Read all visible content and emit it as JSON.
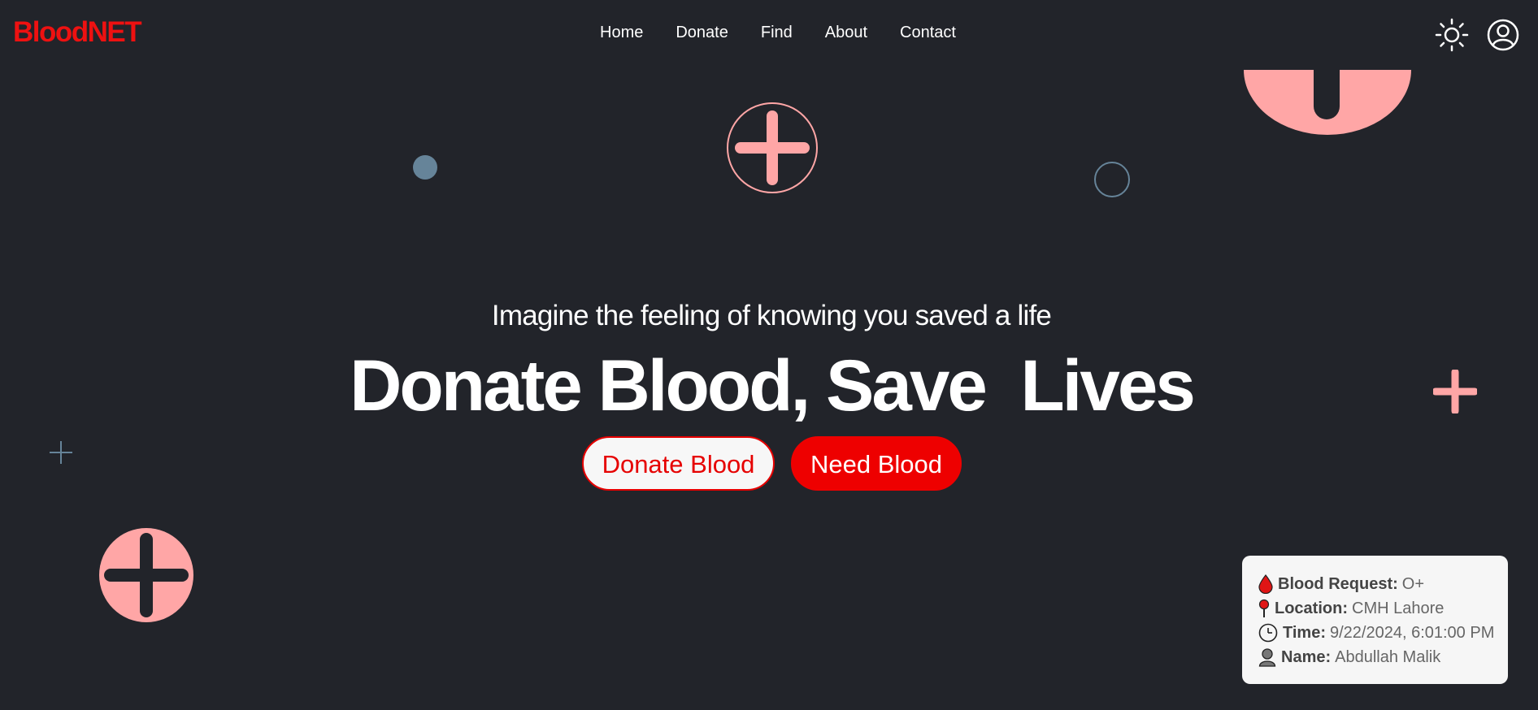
{
  "brand": {
    "logo_text": "BloodNET"
  },
  "nav": {
    "links": [
      "Home",
      "Donate",
      "Find",
      "About",
      "Contact"
    ]
  },
  "header_icons": [
    "sun-theme-toggle-icon",
    "user-profile-icon"
  ],
  "hero": {
    "subtitle": "Imagine the feeling of knowing you saved a life",
    "title": "Donate Blood, Save  Lives",
    "donate_button": "Donate Blood",
    "need_button": "Need Blood"
  },
  "request_card": {
    "blood_label": "Blood Request:",
    "blood_value": "O+",
    "location_label": "Location:",
    "location_value": "CMH Lahore",
    "time_label": "Time:",
    "time_value": "9/22/2024, 6:01:00 PM",
    "name_label": "Name:",
    "name_value": "Abdullah Malik"
  },
  "colors": {
    "background": "#22242a",
    "brand_red": "#ee1111",
    "accent_pink": "#ffa6a6",
    "accent_slate": "#668499",
    "card_bg": "#f6f6f6"
  }
}
